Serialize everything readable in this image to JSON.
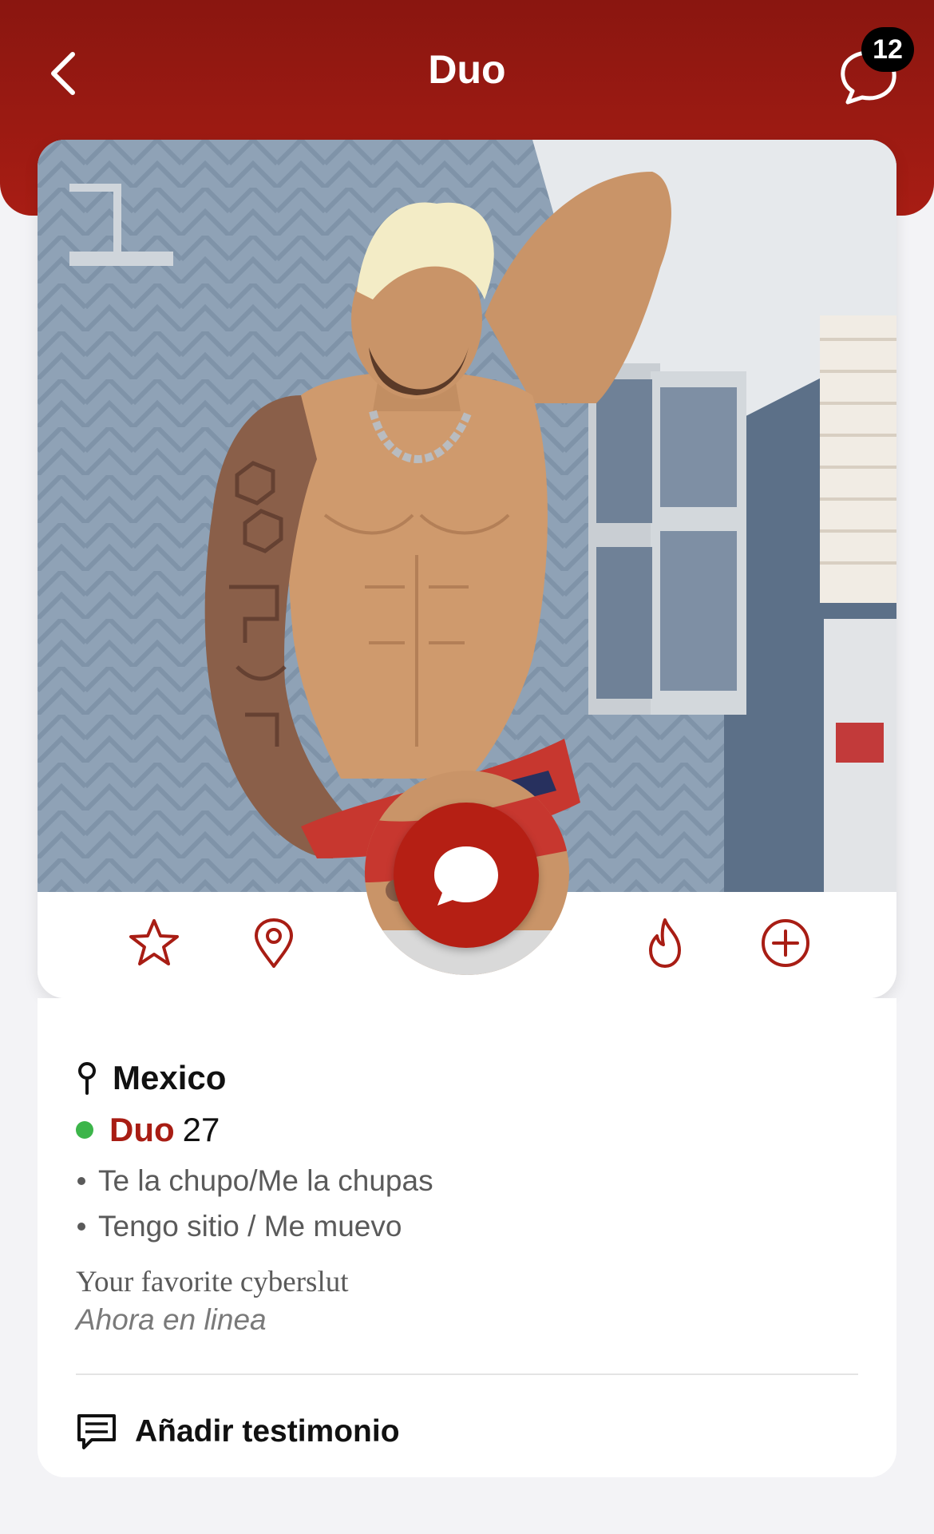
{
  "header": {
    "title": "Duo",
    "back_icon": "chevron-left-icon",
    "chat_icon": "chat-bubble-icon",
    "chat_badge_count": "12"
  },
  "photo": {
    "description_icon": "profile-photo",
    "accent_color": "#b51f14"
  },
  "actions": {
    "favorite_icon": "star-icon",
    "location_icon": "map-pin-icon",
    "message_icon": "chat-bubble-icon",
    "flame_icon": "flame-icon",
    "add_icon": "plus-circle-icon"
  },
  "profile": {
    "location": "Mexico",
    "name": "Duo",
    "age": "27",
    "online_color": "#3cb54a",
    "preferences": [
      "Te la chupo/Me la chupas",
      "Tengo sitio / Me muevo"
    ],
    "bio": "Your favorite cyberslut",
    "status": "Ahora en linea",
    "add_testimonial_label": "Añadir testimonio"
  }
}
